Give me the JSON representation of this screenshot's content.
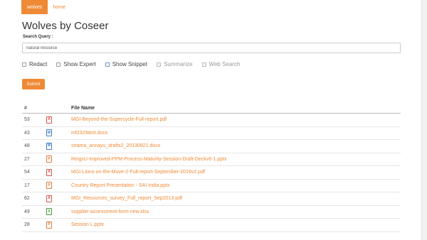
{
  "nav": {
    "items": [
      {
        "label": "wolves",
        "active": true
      },
      {
        "label": "home",
        "active": false
      }
    ]
  },
  "page": {
    "title": "Wolves by Coseer"
  },
  "search": {
    "label": "Search Query :",
    "value": "natural resource",
    "placeholder": ""
  },
  "options": [
    {
      "label": "Redact",
      "checked": false,
      "enabled": true
    },
    {
      "label": "Show Expert",
      "checked": false,
      "enabled": true
    },
    {
      "label": "Show Snippet",
      "checked": false,
      "enabled": true
    },
    {
      "label": "Summarize",
      "checked": false,
      "enabled": false
    },
    {
      "label": "Web Search",
      "checked": false,
      "enabled": false
    }
  ],
  "submit_label": "Submit",
  "table": {
    "headers": {
      "num": "#",
      "icon": "",
      "name": "File Name"
    },
    "rows": [
      {
        "num": "53",
        "icon": "pdf-file-icon",
        "name": "MGI-Beyond-the-Supercycle-Full-report.pdf"
      },
      {
        "num": "43",
        "icon": "word-file-icon",
        "name": "mf2329text.docx"
      },
      {
        "num": "48",
        "icon": "word-file-icon",
        "name": "strama_annayu_draftx2_20130821.docx"
      },
      {
        "num": "27",
        "icon": "powerpoint-file-icon",
        "name": "ReigsU-Improved-PPM-Process-Maturity-Session-Draft-Deckv6-1.pptx"
      },
      {
        "num": "54",
        "icon": "pdf-file-icon",
        "name": "MGI-Lions-on-the-Move-2-Full-report-September-2016v2.pdf"
      },
      {
        "num": "17",
        "icon": "powerpoint-file-icon",
        "name": "Country Report Presentation - SAI India.pptx"
      },
      {
        "num": "62",
        "icon": "pdf-file-icon",
        "name": "MGI_Resources_survey_Full_report_Sep2013.pdf"
      },
      {
        "num": "49",
        "icon": "excel-file-icon",
        "name": "supplier-assessment-form-new.xlsx"
      },
      {
        "num": "28",
        "icon": "powerpoint-file-icon",
        "name": "Session L.pptx"
      }
    ]
  },
  "colors": {
    "accent": "#ee8a35",
    "pdf": "#d9534f",
    "word": "#3d7ec6",
    "powerpoint": "#e07b3b",
    "excel": "#4a9a3e"
  }
}
